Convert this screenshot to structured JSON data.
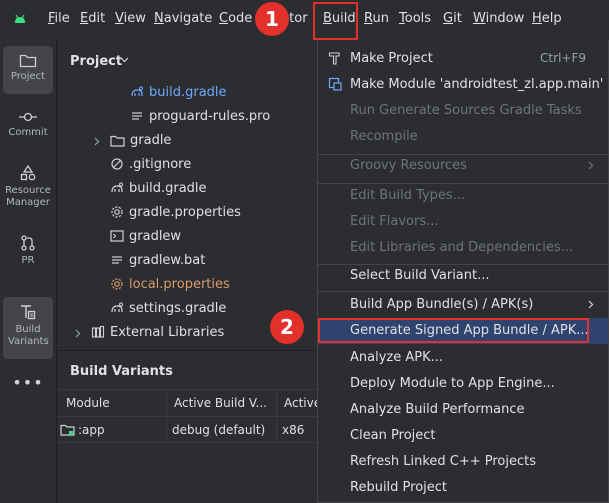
{
  "menubar": {
    "items": [
      {
        "label": "File",
        "u": "F",
        "rest": "ile"
      },
      {
        "label": "Edit",
        "u": "E",
        "rest": "dit"
      },
      {
        "label": "View",
        "u": "V",
        "rest": "iew"
      },
      {
        "label": "Navigate",
        "u": "N",
        "rest": "avigate"
      },
      {
        "label": "Code",
        "u": "C",
        "rest": "ode"
      },
      {
        "label": "ctor",
        "u": "",
        "rest": "ctor"
      },
      {
        "label": "Build",
        "u": "B",
        "rest": "uild"
      },
      {
        "label": "Run",
        "u": "R",
        "rest": "un"
      },
      {
        "label": "Tools",
        "u": "T",
        "rest": "ools"
      },
      {
        "label": "Git",
        "u": "G",
        "rest": "it"
      },
      {
        "label": "Window",
        "u": "W",
        "rest": "indow"
      },
      {
        "label": "Help",
        "u": "H",
        "rest": "elp"
      }
    ]
  },
  "toolstrip": {
    "project": "Project",
    "commit": "Commit",
    "resource_manager": "Resource Manager",
    "pr": "PR",
    "build_variants": "Build Variants"
  },
  "project_panel": {
    "title": "Project",
    "tree": [
      {
        "label": "build.gradle"
      },
      {
        "label": "proguard-rules.pro"
      },
      {
        "label": "gradle"
      },
      {
        "label": ".gitignore"
      },
      {
        "label": "build.gradle"
      },
      {
        "label": "gradle.properties"
      },
      {
        "label": "gradlew"
      },
      {
        "label": "gradlew.bat"
      },
      {
        "label": "local.properties"
      },
      {
        "label": "settings.gradle"
      },
      {
        "label": "External Libraries"
      }
    ]
  },
  "build_variants": {
    "title": "Build Variants",
    "columns": [
      "Module",
      "Active Build V...",
      "Active"
    ],
    "row": {
      "module": ":app",
      "variant": "debug (default)",
      "abi": "x86"
    }
  },
  "build_menu": {
    "items": [
      {
        "label": "Make Project",
        "shortcut": "Ctrl+F9"
      },
      {
        "label": "Make Module 'androidtest_zl.app.main'"
      },
      {
        "label": "Run Generate Sources Gradle Tasks"
      },
      {
        "label": "Recompile"
      },
      {
        "label": "Groovy Resources"
      },
      {
        "label": "Edit Build Types..."
      },
      {
        "label": "Edit Flavors..."
      },
      {
        "label": "Edit Libraries and Dependencies..."
      },
      {
        "label": "Select Build Variant..."
      },
      {
        "label": "Build App Bundle(s) / APK(s)"
      },
      {
        "label": "Generate Signed App Bundle / APK..."
      },
      {
        "label": "Analyze APK..."
      },
      {
        "label": "Deploy Module to App Engine..."
      },
      {
        "label": "Analyze Build Performance"
      },
      {
        "label": "Clean Project"
      },
      {
        "label": "Refresh Linked C++ Projects"
      },
      {
        "label": "Rebuild Project"
      }
    ]
  },
  "annotations": {
    "one": "1",
    "two": "2"
  },
  "colors": {
    "accent_red": "#e3302b",
    "highlight": "#2e436e",
    "link_blue": "#6fa8ff",
    "local_orange": "#d99b6a"
  }
}
